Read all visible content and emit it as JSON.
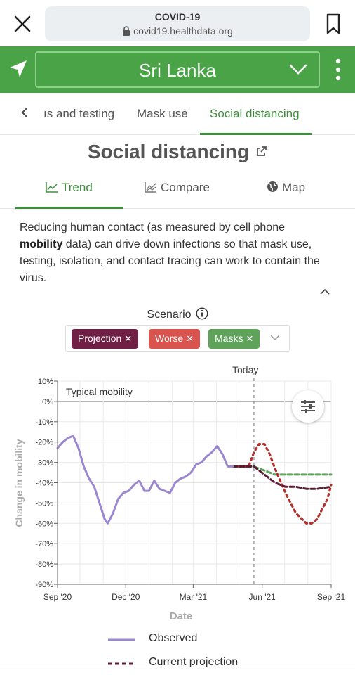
{
  "browser": {
    "page_title": "COVID-19",
    "url": "covid19.healthdata.org"
  },
  "location": {
    "country": "Sri Lanka"
  },
  "tabs": {
    "items": [
      {
        "label": "ıs and testing"
      },
      {
        "label": "Mask use"
      },
      {
        "label": "Social distancing"
      }
    ],
    "active_index": 2
  },
  "page_heading": "Social distancing",
  "view_tabs": [
    {
      "label": "Trend"
    },
    {
      "label": "Compare"
    },
    {
      "label": "Map"
    }
  ],
  "description": {
    "part1": "Reducing human contact (as measured by cell phone ",
    "bold": "mobility",
    "part2": " data) can drive down infections so that mask use, testing, isolation, and contact tracing can work to contain the virus."
  },
  "scenario": {
    "label": "Scenario",
    "chips": [
      {
        "label": "Projection",
        "color": "#6f2044"
      },
      {
        "label": "Worse",
        "color": "#d9534f"
      },
      {
        "label": "Masks",
        "color": "#5fa35a"
      }
    ]
  },
  "colors": {
    "brand_green": "#4aa347",
    "active_green": "#3e8f3b",
    "observed": "#9b87d0",
    "projection": "#5c1a33",
    "worse": "#b5302b",
    "masks": "#5fa35a"
  },
  "chart_data": {
    "type": "line",
    "annotation_today": "Today",
    "annotation_baseline": "Typical mobility",
    "ylabel": "Change in mobility",
    "xlabel": "Date",
    "ylim": [
      -90,
      10
    ],
    "yticks": [
      "10%",
      "0%",
      "-10%",
      "-20%",
      "-30%",
      "-40%",
      "-50%",
      "-60%",
      "-70%",
      "-80%",
      "-90%"
    ],
    "xticks": [
      "Sep '20",
      "Dec '20",
      "Mar '21",
      "Jun '21",
      "Sep '21"
    ],
    "x_range": [
      "2020-09-01",
      "2021-09-01"
    ],
    "today": "2021-05-21",
    "series": [
      {
        "name": "Observed",
        "style": "solid",
        "points": [
          [
            "2020-09-01",
            -23
          ],
          [
            "2020-09-08",
            -20
          ],
          [
            "2020-09-15",
            -18
          ],
          [
            "2020-09-22",
            -17
          ],
          [
            "2020-09-29",
            -23
          ],
          [
            "2020-10-06",
            -32
          ],
          [
            "2020-10-13",
            -38
          ],
          [
            "2020-10-20",
            -42
          ],
          [
            "2020-10-27",
            -50
          ],
          [
            "2020-11-03",
            -58
          ],
          [
            "2020-11-07",
            -60
          ],
          [
            "2020-11-14",
            -55
          ],
          [
            "2020-11-21",
            -48
          ],
          [
            "2020-11-28",
            -45
          ],
          [
            "2020-12-05",
            -44
          ],
          [
            "2020-12-12",
            -41
          ],
          [
            "2020-12-19",
            -39
          ],
          [
            "2020-12-26",
            -44
          ],
          [
            "2021-01-01",
            -44
          ],
          [
            "2021-01-08",
            -39
          ],
          [
            "2021-01-15",
            -43
          ],
          [
            "2021-01-22",
            -44
          ],
          [
            "2021-01-29",
            -45
          ],
          [
            "2021-02-05",
            -40
          ],
          [
            "2021-02-12",
            -38
          ],
          [
            "2021-02-19",
            -37
          ],
          [
            "2021-02-26",
            -35
          ],
          [
            "2021-03-05",
            -31
          ],
          [
            "2021-03-12",
            -30
          ],
          [
            "2021-03-19",
            -27
          ],
          [
            "2021-03-26",
            -25
          ],
          [
            "2021-04-02",
            -22
          ],
          [
            "2021-04-09",
            -26
          ],
          [
            "2021-04-16",
            -32
          ],
          [
            "2021-04-23",
            -32
          ]
        ]
      },
      {
        "name": "Current projection",
        "style": "dashed",
        "points": [
          [
            "2021-04-23",
            -32
          ],
          [
            "2021-05-07",
            -32
          ],
          [
            "2021-05-21",
            -32
          ],
          [
            "2021-06-04",
            -36
          ],
          [
            "2021-06-18",
            -40
          ],
          [
            "2021-07-02",
            -42
          ],
          [
            "2021-07-16",
            -42
          ],
          [
            "2021-07-30",
            -43
          ],
          [
            "2021-08-13",
            -43
          ],
          [
            "2021-09-01",
            -42
          ]
        ]
      },
      {
        "name": "Worse",
        "style": "dotted",
        "points": [
          [
            "2021-04-23",
            -32
          ],
          [
            "2021-05-14",
            -32
          ],
          [
            "2021-05-21",
            -25
          ],
          [
            "2021-05-28",
            -21
          ],
          [
            "2021-06-04",
            -21
          ],
          [
            "2021-06-11",
            -26
          ],
          [
            "2021-06-18",
            -33
          ],
          [
            "2021-07-02",
            -45
          ],
          [
            "2021-07-16",
            -55
          ],
          [
            "2021-07-30",
            -60
          ],
          [
            "2021-08-06",
            -60
          ],
          [
            "2021-08-13",
            -58
          ],
          [
            "2021-08-27",
            -48
          ],
          [
            "2021-09-01",
            -41
          ]
        ]
      },
      {
        "name": "Masks",
        "style": "dashed",
        "points": [
          [
            "2021-04-23",
            -32
          ],
          [
            "2021-05-21",
            -32
          ],
          [
            "2021-06-04",
            -34
          ],
          [
            "2021-06-18",
            -36
          ],
          [
            "2021-07-02",
            -36
          ],
          [
            "2021-07-30",
            -36
          ],
          [
            "2021-09-01",
            -36
          ]
        ]
      }
    ]
  },
  "legend": [
    {
      "label": "Observed",
      "color": "#9b87d0",
      "style": "solid"
    },
    {
      "label": "Current projection",
      "color": "#5c1a33",
      "style": "dashed"
    }
  ]
}
